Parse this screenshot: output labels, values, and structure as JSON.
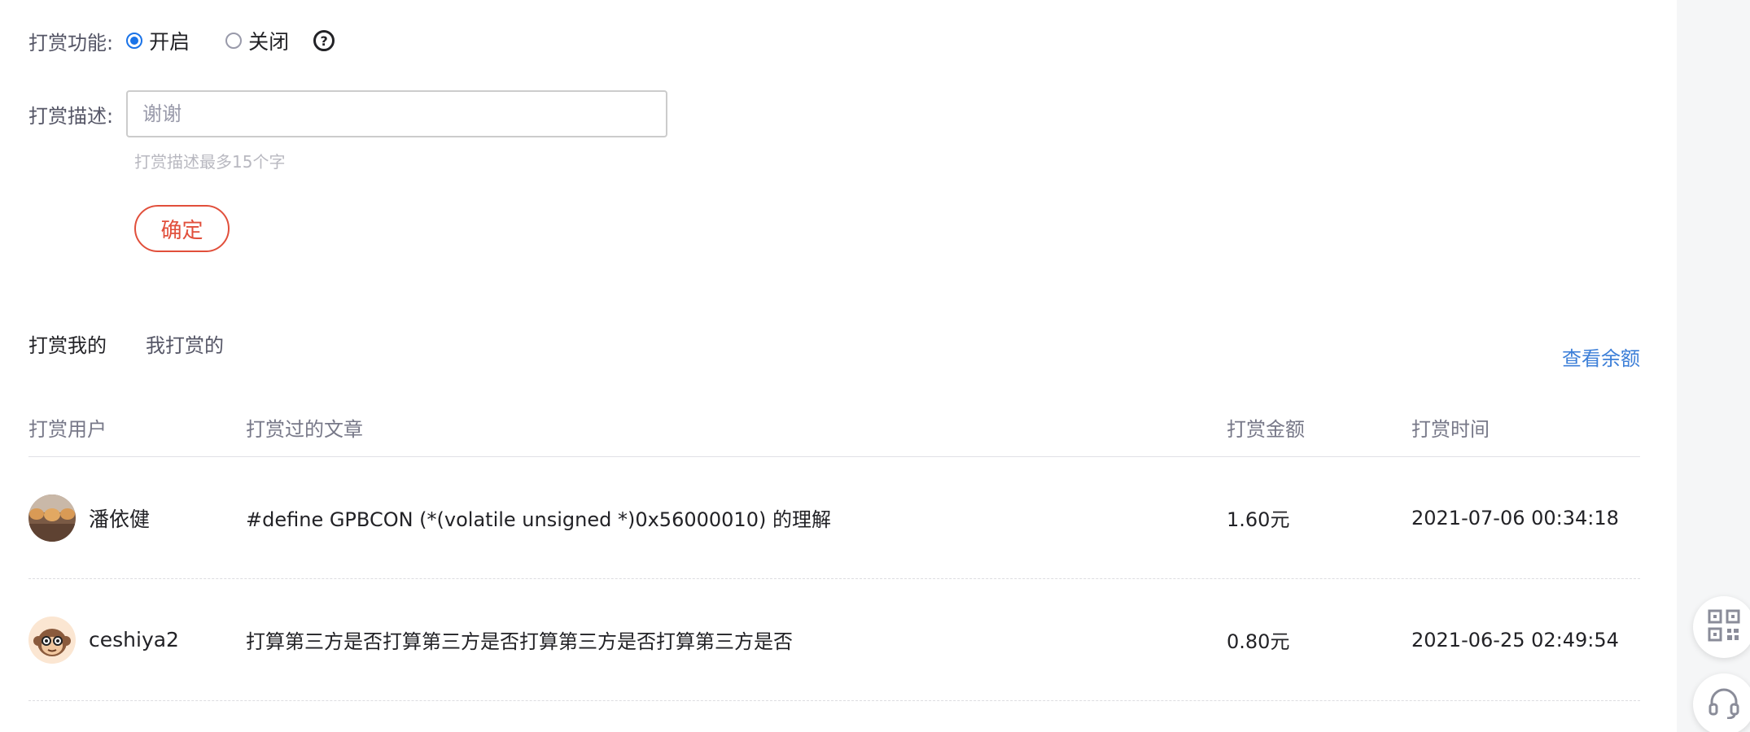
{
  "reward_settings": {
    "function_label": "打赏功能:",
    "option_on": "开启",
    "option_off": "关闭",
    "selected": "开启",
    "desc_label": "打赏描述:",
    "desc_placeholder": "谢谢",
    "desc_value": "",
    "hint": "打赏描述最多15个字",
    "confirm_label": "确定"
  },
  "tabs": [
    {
      "label": "打赏我的",
      "active": true
    },
    {
      "label": "我打赏的",
      "active": false
    }
  ],
  "balance_link": "查看余额",
  "table": {
    "headers": [
      "打赏用户",
      "打赏过的文章",
      "打赏金额",
      "打赏时间"
    ],
    "rows": [
      {
        "user": "潘依健",
        "article": "#define GPBCON (*(volatile unsigned *)0x56000010) 的理解",
        "amount": "1.60元",
        "time": "2021-07-06 00:34:18"
      },
      {
        "user": "ceshiya2",
        "article": "打算第三方是否打算第三方是否打算第三方是否打算第三方是否",
        "amount": "0.80元",
        "time": "2021-06-25 02:49:54"
      }
    ]
  },
  "icons": {
    "help": "help-circle-icon",
    "qrcode": "qrcode-icon",
    "support": "headset-icon"
  },
  "colors": {
    "accent_blue": "#1a73e8",
    "link_blue": "#3d7fd8",
    "confirm_red": "#e14f3b"
  }
}
